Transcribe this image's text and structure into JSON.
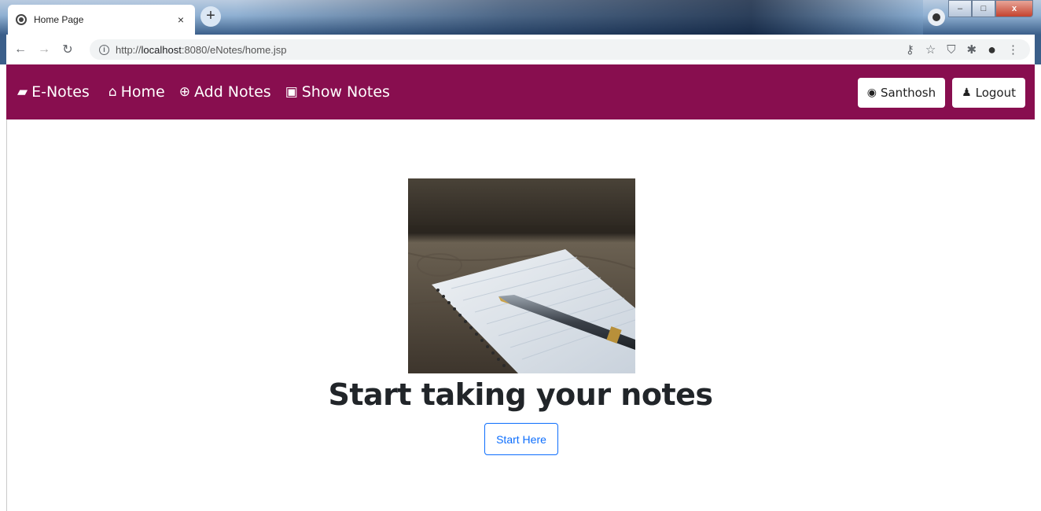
{
  "browser": {
    "tab_title": "Home Page",
    "tab_close": "×",
    "new_tab": "+",
    "url_prefix": "http://",
    "url_host": "localhost",
    "url_rest": ":8080/eNotes/home.jsp",
    "window_minimize": "–",
    "window_maximize": "□",
    "window_close": "x"
  },
  "navbar": {
    "brand": "E-Notes",
    "items": [
      {
        "label": "Home",
        "icon": "home-icon"
      },
      {
        "label": "Add Notes",
        "icon": "plus-circle-icon"
      },
      {
        "label": "Show Notes",
        "icon": "address-book-icon"
      }
    ],
    "user_button": "Santhosh",
    "logout_button": "Logout",
    "bg_color": "#880e4f"
  },
  "main": {
    "heading": "Start taking your notes",
    "cta_label": "Start Here",
    "image_icon": "notebook-with-pen-photo"
  }
}
